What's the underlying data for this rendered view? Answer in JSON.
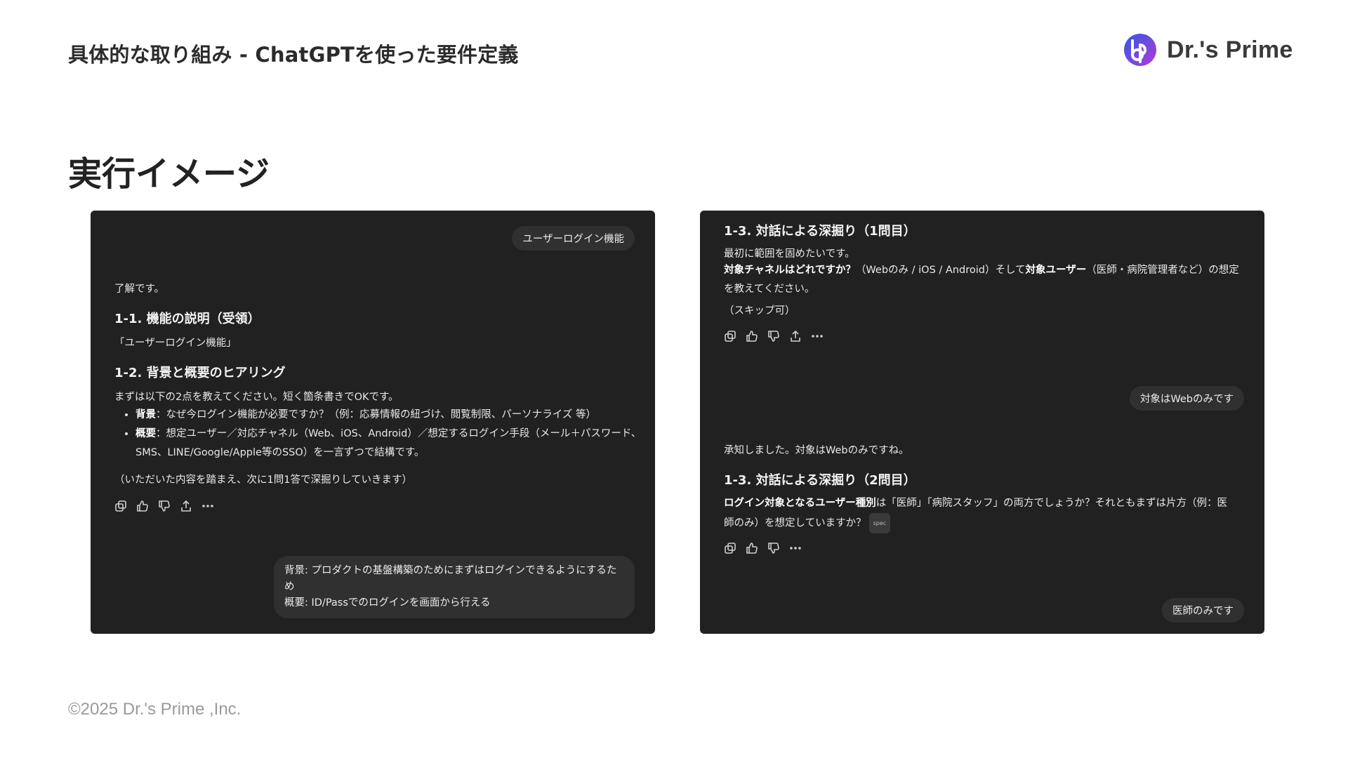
{
  "header": {
    "title": "具体的な取り組み - ChatGPTを使った要件定義",
    "logo_text": "Dr.'s Prime",
    "logo_colors": [
      "#2f5be0",
      "#b23bd6"
    ]
  },
  "section_title": "実行イメージ",
  "left_panel": {
    "user_bubble_1": "ユーザーログイン機能",
    "reply_intro": "了解です。",
    "h1": "1-1. 機能の説明（受領）",
    "h1_body": "「ユーザーログイン機能」",
    "h2": "1-2. 背景と概要のヒアリング",
    "h2_body": "まずは以下の2点を教えてください。短く箇条書きでOKです。",
    "bullets": [
      {
        "term": "背景",
        "text": "：なぜ今ログイン機能が必要ですか？（例：応募情報の紐づけ、閲覧制限、パーソナライズ 等）"
      },
      {
        "term": "概要",
        "text": "：想定ユーザー／対応チャネル（Web、iOS、Android）／想定するログイン手段（メール＋パスワード、SMS、LINE/Google/Apple等のSSO）を一言ずつで結構です。"
      }
    ],
    "closing": "（いただいた内容を踏まえ、次に1問1答で深掘りしていきます）",
    "user_bubble_2": {
      "line1": "背景: プロダクトの基盤構築のためにまずはログインできるようにするため",
      "line2": "概要: ID/Passでのログインを画面から行える"
    }
  },
  "right_panel": {
    "h1": "1-3. 対話による深掘り（1問目）",
    "p1": "最初に範囲を固めたいです。",
    "p2_bold1": "対象チャネルはどれですか？",
    "p2_mid": "（Webのみ / iOS / Android）そして",
    "p2_bold2": "対象ユーザー",
    "p2_end": "（医師・病院管理者など）の想定を教えてください。",
    "p3": "（スキップ可）",
    "user_bubble_1": "対象はWebのみです",
    "reply2_intro": "承知しました。対象はWebのみですね。",
    "h2": "1-3. 対話による深掘り（2問目）",
    "q2_bold": "ログイン対象となるユーザー種別",
    "q2_rest": "は「医師」「病院スタッフ」の両方でしょうか？それともまずは片方（例：医師のみ）を想定していますか？",
    "tag": "spec",
    "user_bubble_2": "医師のみです"
  },
  "footer": "©2025 Dr.'s Prime ,Inc."
}
